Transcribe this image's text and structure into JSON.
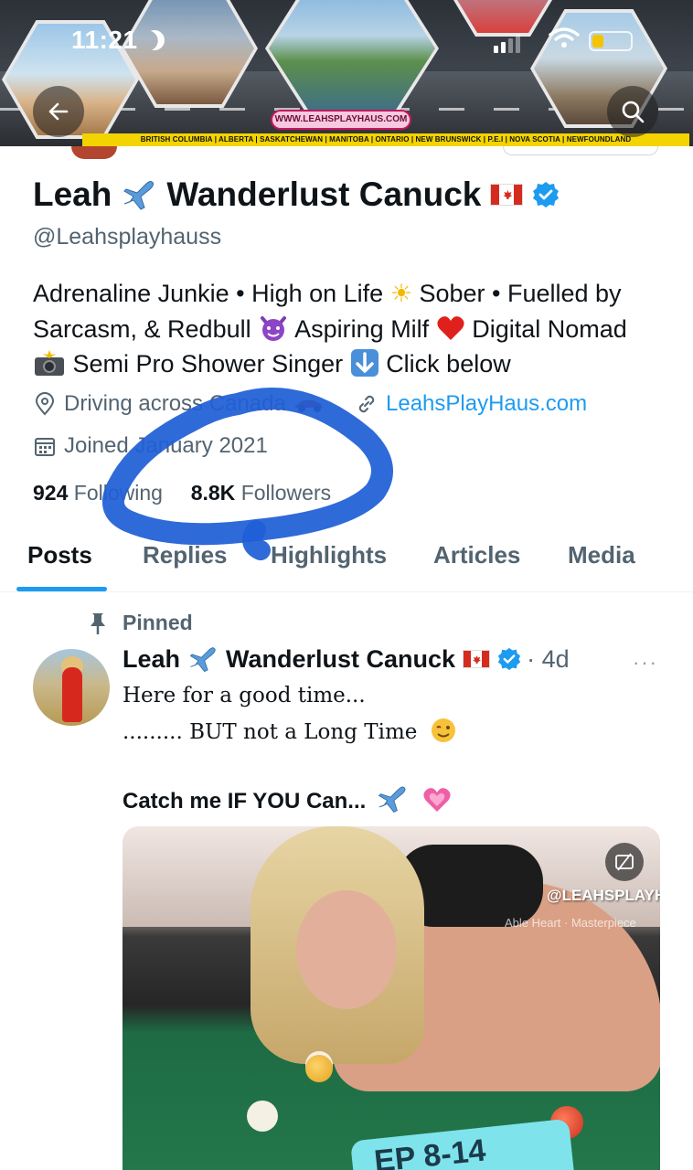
{
  "status_bar": {
    "time": "11:21"
  },
  "banner": {
    "website": "WWW.LEAHSPLAYHAUS.COM",
    "provinces": "BRITISH COLUMBIA | ALBERTA | SASKATCHEWAN | MANITOBA | ONTARIO | NEW BRUNSWICK | P.E.I | NOVA SCOTIA | NEWFOUNDLAND"
  },
  "profile": {
    "name_first": "Leah",
    "name_rest": "Wanderlust Canuck",
    "handle": "@Leahsplayhauss",
    "bio_line1": "Adrenaline Junkie • High on Life",
    "bio_line1b": "Sober • Fuelled by",
    "bio_line2a": "Sarcasm, & Redbull",
    "bio_line2b": "Aspiring Milf",
    "bio_line2c": "Digital Nomad",
    "bio_line3a": "Semi Pro Shower Singer",
    "bio_line3b": "Click below",
    "location": "Driving across Canada",
    "website": "LeahsPlayHaus.com",
    "joined": "Joined January 2021",
    "following_count": "924",
    "following_label": "Following",
    "followers_count": "8.8K",
    "followers_label": "Followers"
  },
  "tabs": [
    "Posts",
    "Replies",
    "Highlights",
    "Articles",
    "Media"
  ],
  "post": {
    "pinned_label": "Pinned",
    "author_first": "Leah",
    "author_rest": "Wanderlust Canuck",
    "time": "4d",
    "more": "···",
    "line1": "Here for a good time...",
    "line2": "......... BUT not a Long Time",
    "line3": "Catch me IF YOU Can...",
    "media_watermark": "@LEAHSPLAYHAUS",
    "media_watermark2": "Able Heart · Masterpiece",
    "media_sticker": "EP 8-14"
  },
  "colors": {
    "accent": "#1d9bf0",
    "text_primary": "#0f1419",
    "text_secondary": "#536471",
    "scribble": "#1f5fd6"
  },
  "icons": [
    "back-arrow-icon",
    "search-icon",
    "location-icon",
    "link-icon",
    "calendar-icon",
    "verified-badge-icon",
    "pin-icon",
    "more-icon",
    "captions-icon"
  ]
}
